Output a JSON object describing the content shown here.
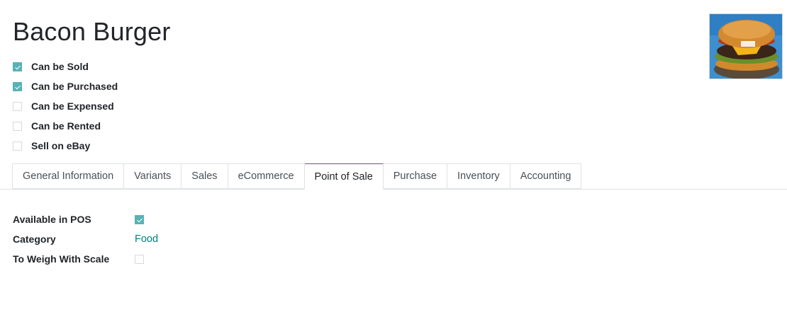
{
  "product": {
    "name": "Bacon Burger",
    "image": "burger-image"
  },
  "options": [
    {
      "label": "Can be Sold",
      "checked": true
    },
    {
      "label": "Can be Purchased",
      "checked": true
    },
    {
      "label": "Can be Expensed",
      "checked": false
    },
    {
      "label": "Can be Rented",
      "checked": false
    },
    {
      "label": "Sell on eBay",
      "checked": false
    }
  ],
  "tabs": [
    {
      "label": "General Information",
      "active": false
    },
    {
      "label": "Variants",
      "active": false
    },
    {
      "label": "Sales",
      "active": false
    },
    {
      "label": "eCommerce",
      "active": false
    },
    {
      "label": "Point of Sale",
      "active": true
    },
    {
      "label": "Purchase",
      "active": false
    },
    {
      "label": "Inventory",
      "active": false
    },
    {
      "label": "Accounting",
      "active": false
    }
  ],
  "pos": {
    "available_label": "Available in POS",
    "available": true,
    "category_label": "Category",
    "category_value": "Food",
    "weigh_label": "To Weigh With Scale",
    "weigh": false
  },
  "colors": {
    "accent": "#017e84",
    "checkbox_on": "#58b2b5",
    "active_tab_top": "#6b5a72"
  }
}
